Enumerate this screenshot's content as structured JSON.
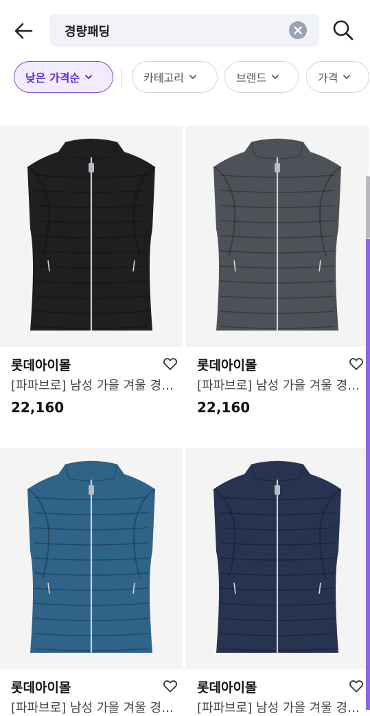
{
  "search": {
    "query": "경량패딩"
  },
  "filters": [
    {
      "label": "낮은 가격순",
      "active": true
    },
    {
      "label": "카테고리",
      "active": false
    },
    {
      "label": "브랜드",
      "active": false
    },
    {
      "label": "가격",
      "active": false
    }
  ],
  "products": [
    {
      "seller": "롯데아이몰",
      "name": "[파파브로] 남성 가을 겨울 경량패딩 조끼",
      "price": "22,160",
      "color": "#1f1f21"
    },
    {
      "seller": "롯데아이몰",
      "name": "[파파브로] 남성 가을 겨울 경량패딩 조끼",
      "price": "22,160",
      "color": "#4d5158"
    },
    {
      "seller": "롯데아이몰",
      "name": "[파파브로] 남성 가을 겨울 경량패딩 조끼",
      "price": "",
      "color": "#2f6388"
    },
    {
      "seller": "롯데아이몰",
      "name": "[파파브로] 남성 가을 겨울 경량패딩 조끼",
      "price": "",
      "color": "#283352"
    }
  ],
  "colors": {
    "accent": "#7d4fd4",
    "accent_bg": "#f2ecff"
  },
  "icons": {
    "back": "arrow-left-icon",
    "clear": "close-circle-icon",
    "search": "search-icon",
    "wishlist": "heart-outline-icon"
  }
}
